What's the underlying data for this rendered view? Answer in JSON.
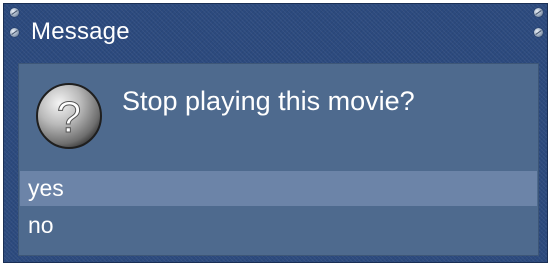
{
  "dialog": {
    "title": "Message",
    "question": "Stop playing this movie?",
    "icon": "question-icon",
    "options": [
      {
        "label": "yes",
        "selected": true
      },
      {
        "label": "no",
        "selected": false
      }
    ]
  },
  "colors": {
    "frame": "#2c4a7e",
    "panel": "#4e6a8e",
    "selected_row": "#6c84a8",
    "text": "#ffffff"
  }
}
